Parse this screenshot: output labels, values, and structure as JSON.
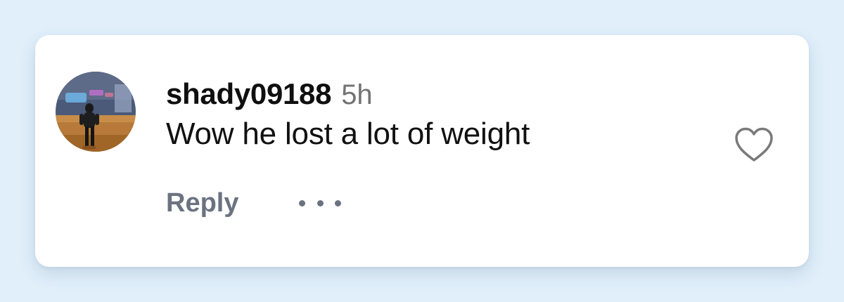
{
  "comment": {
    "username": "shady09188",
    "timestamp": "5h",
    "text": "Wow he lost a lot of weight"
  },
  "actions": {
    "reply_label": "Reply",
    "more_icon": "more-horizontal-icon",
    "like_icon": "heart-outline-icon"
  },
  "colors": {
    "background": "#e0effa",
    "card": "#ffffff",
    "username": "#0f0f0f",
    "muted": "#737373",
    "action": "#6b7280"
  }
}
